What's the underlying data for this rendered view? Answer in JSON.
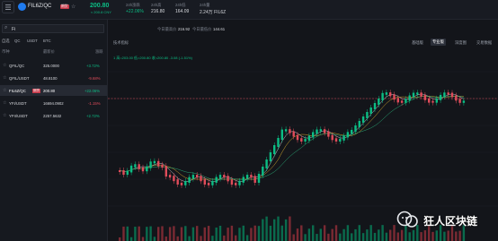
{
  "header": {
    "pair": "FIL6Z/QC",
    "badge": "期货",
    "price": "200.80",
    "sub_price": "≈ 200.8 CNY",
    "stats": [
      {
        "label": "24h涨跌",
        "value": "+22.06%"
      },
      {
        "label": "24h高",
        "value": "216.80"
      },
      {
        "label": "24h低",
        "value": "164.09"
      },
      {
        "label": "24h量",
        "value": "2.24万 FIL6Z"
      }
    ]
  },
  "sidebar": {
    "search_value": "Fi",
    "tabs": [
      "自选",
      "QC",
      "USDT",
      "BTC"
    ],
    "columns": [
      "币种",
      "最新价",
      "涨跌"
    ],
    "rows": [
      {
        "star": "☆",
        "name": "QFIL/QC",
        "price": "325.0000",
        "change": "+3.72%",
        "dir": "up"
      },
      {
        "star": "☆",
        "name": "QFIL/USDT",
        "price": "48.8100",
        "change": "-9.68%",
        "dir": "down"
      },
      {
        "star": "☆",
        "name": "FIL6Z/QC",
        "tag": "期货",
        "price": "200.80",
        "change": "+22.06%",
        "dir": "up",
        "selected": true
      },
      {
        "star": "☆",
        "name": "YFI/USDT",
        "price": "16694.0902",
        "change": "-1.15%",
        "dir": "down"
      },
      {
        "star": "☆",
        "name": "YFII/USDT",
        "price": "2257.5632",
        "change": "+2.72%",
        "dir": "up"
      }
    ]
  },
  "chart_header": {
    "today_high_label": "今日最高价",
    "today_high": "216.92",
    "today_low_label": "今日最低价",
    "today_low": "144.61",
    "indicator_label": "技术指标",
    "views": [
      "基础版",
      "专业版",
      "深度图",
      "交易数据"
    ],
    "active_view": "专业版",
    "ohlc": "1 高=203.00  低=200.80  收=200.80  -3.08 (-1.51%)"
  },
  "watermark": {
    "text": "狂人区块链"
  },
  "colors": {
    "up": "#0bbd84",
    "down": "#e04c5a",
    "bg": "#13151a"
  }
}
